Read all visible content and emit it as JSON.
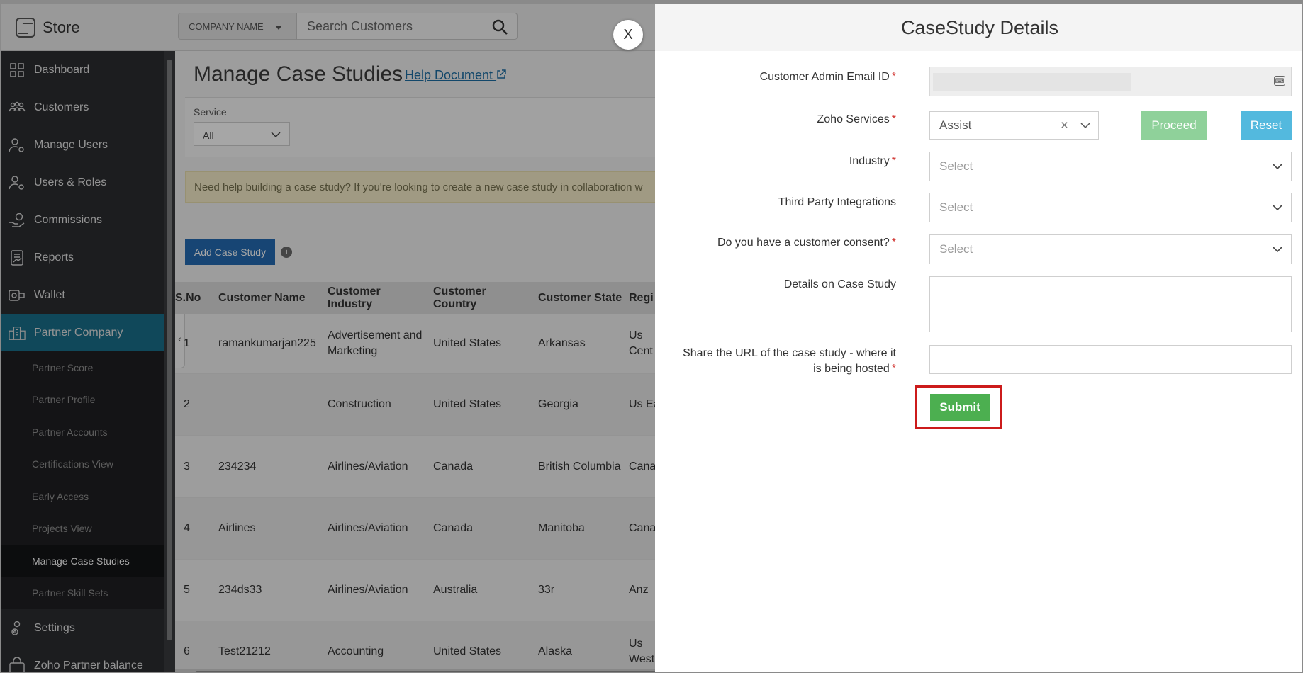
{
  "app": {
    "brand": "Store"
  },
  "topbar": {
    "company_label": "COMPANY NAME",
    "search_placeholder": "Search Customers"
  },
  "sidebar": {
    "items": [
      {
        "label": "Dashboard",
        "icon": "grid-icon"
      },
      {
        "label": "Customers",
        "icon": "users-icon"
      },
      {
        "label": "Manage Users",
        "icon": "user-gear-icon"
      },
      {
        "label": "Users & Roles",
        "icon": "user-gear-icon"
      },
      {
        "label": "Commissions",
        "icon": "hand-coin-icon"
      },
      {
        "label": "Reports",
        "icon": "report-icon"
      },
      {
        "label": "Wallet",
        "icon": "wallet-icon"
      },
      {
        "label": "Partner Company",
        "icon": "building-icon"
      }
    ],
    "sub_items": [
      "Partner Score",
      "Partner Profile",
      "Partner Accounts",
      "Certifications View",
      "Early Access",
      "Projects View",
      "Manage Case Studies",
      "Partner Skill Sets"
    ],
    "bottom_items": [
      {
        "label": "Settings",
        "icon": "gear-icon"
      },
      {
        "label": "Zoho Partner balance",
        "icon": "bag-icon"
      }
    ]
  },
  "main": {
    "title": "Manage Case Studies",
    "help_link": "Help Document",
    "filter": {
      "label": "Service",
      "value": "All"
    },
    "notice": "Need help building a case study? If you're looking to create a new case study in collaboration w",
    "add_button": "Add Case Study",
    "info_icon": "i",
    "table": {
      "headers": [
        "S.No",
        "Customer Name",
        "Customer Industry",
        "Customer Country",
        "Customer State",
        "Regi"
      ],
      "rows": [
        [
          "1",
          "ramankumarjan225",
          "Advertisement and Marketing",
          "United States",
          "Arkansas",
          "Us Cent"
        ],
        [
          "2",
          "",
          "Construction",
          "United States",
          "Georgia",
          "Us Ea"
        ],
        [
          "3",
          "234234",
          "Airlines/Aviation",
          "Canada",
          "British Columbia",
          "Cana"
        ],
        [
          "4",
          "Airlines",
          "Airlines/Aviation",
          "Canada",
          "Manitoba",
          "Cana"
        ],
        [
          "5",
          "234ds33",
          "Airlines/Aviation",
          "Australia",
          "33r",
          "Anz"
        ],
        [
          "6",
          "Test21212",
          "Accounting",
          "United States",
          "Alaska",
          "Us West"
        ]
      ]
    }
  },
  "modal": {
    "close": "X",
    "title": "CaseStudy Details",
    "required_mark": "*",
    "fields": {
      "email_label": "Customer Admin Email ID",
      "services_label": "Zoho Services",
      "services_value": "Assist",
      "industry_label": "Industry",
      "industry_placeholder": "Select",
      "integrations_label": "Third Party Integrations",
      "integrations_placeholder": "Select",
      "consent_label": "Do you have a customer consent?",
      "consent_placeholder": "Select",
      "details_label": "Details on Case Study",
      "url_label_line1": "Share the URL of the case study - where it",
      "url_label_line2": "is being hosted"
    },
    "proceed_button": "Proceed",
    "reset_button": "Reset",
    "submit_button": "Submit"
  }
}
